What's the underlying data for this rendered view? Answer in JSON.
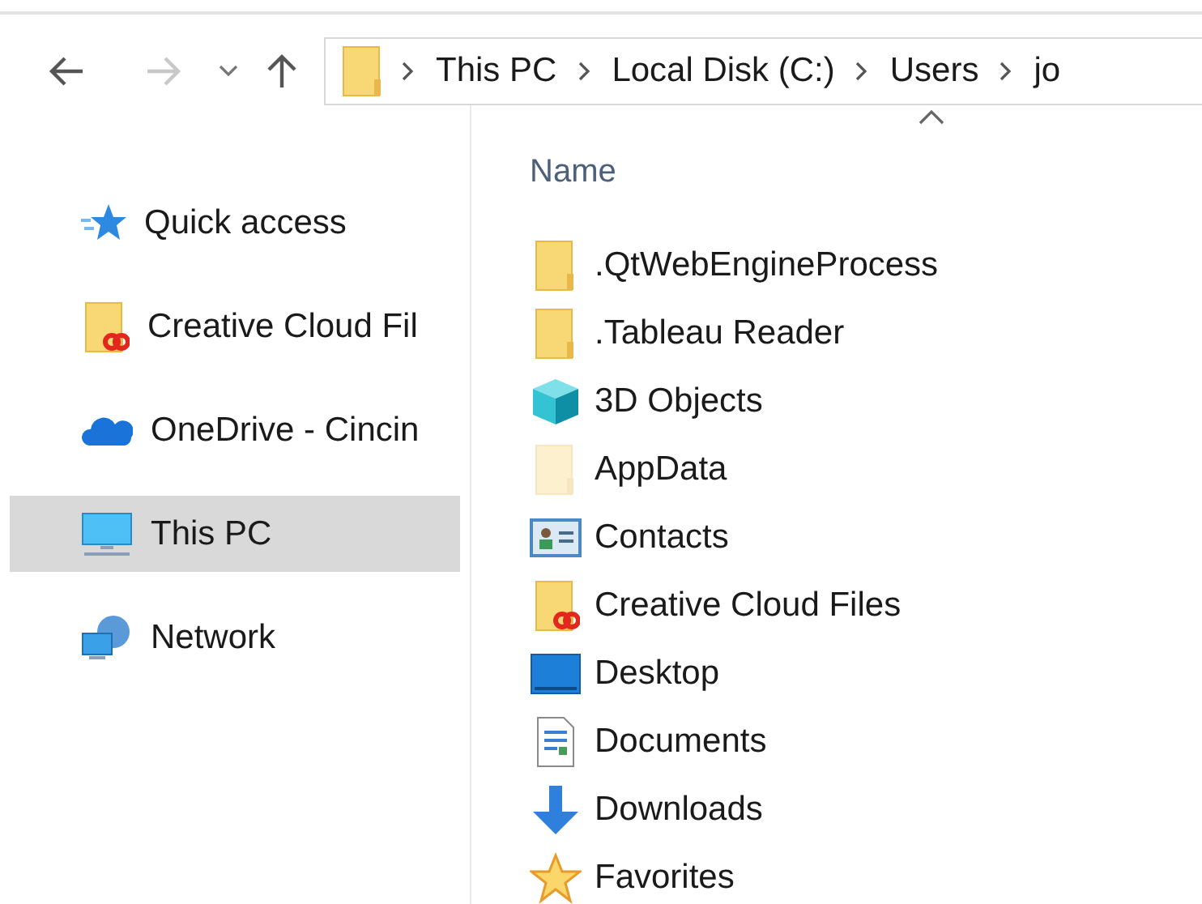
{
  "toolbar": {
    "breadcrumb": [
      "This PC",
      "Local Disk (C:)",
      "Users",
      "jo"
    ]
  },
  "sidebar": {
    "items": [
      {
        "label": "Quick access",
        "kind": "quick",
        "selected": false
      },
      {
        "label": "Creative Cloud Fil",
        "kind": "cc",
        "selected": false
      },
      {
        "label": "OneDrive - Cincin",
        "kind": "cloud",
        "selected": false
      },
      {
        "label": "This PC",
        "kind": "pc",
        "selected": true
      },
      {
        "label": "Network",
        "kind": "network",
        "selected": false
      }
    ]
  },
  "file_list": {
    "column": "Name",
    "items": [
      {
        "name": ".QtWebEngineProcess",
        "kind": "folder"
      },
      {
        "name": ".Tableau Reader",
        "kind": "folder"
      },
      {
        "name": "3D Objects",
        "kind": "cube"
      },
      {
        "name": "AppData",
        "kind": "hidden"
      },
      {
        "name": "Contacts",
        "kind": "contacts"
      },
      {
        "name": "Creative Cloud Files",
        "kind": "cc"
      },
      {
        "name": "Desktop",
        "kind": "desktop"
      },
      {
        "name": "Documents",
        "kind": "document"
      },
      {
        "name": "Downloads",
        "kind": "download"
      },
      {
        "name": "Favorites",
        "kind": "star"
      }
    ]
  }
}
